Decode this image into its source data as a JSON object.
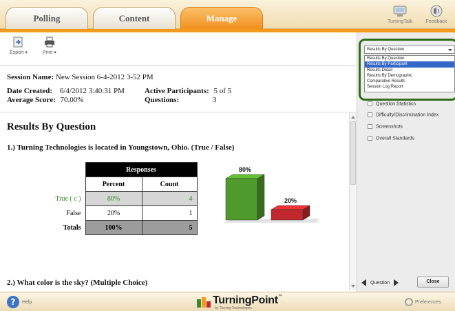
{
  "tabs": [
    {
      "label": "Polling",
      "active": false
    },
    {
      "label": "Content",
      "active": false
    },
    {
      "label": "Manage",
      "active": true
    }
  ],
  "top_actions": {
    "turningtalk": "TurningTalk",
    "feedback": "Feedback"
  },
  "toolbar": {
    "export": "Export",
    "print": "Print"
  },
  "session": {
    "name_label": "Session Name:",
    "name_value": "New Session 6-4-2012 3-52 PM",
    "date_label": "Date Created:",
    "date_value": "6/4/2012 3:40:31 PM",
    "avg_label": "Average Score:",
    "avg_value": "70.00%",
    "participants_label": "Active Participants:",
    "participants_value": "5 of 5",
    "questions_label": "Questions:",
    "questions_value": "3"
  },
  "report": {
    "title": "Results By Question",
    "q1": "1.) Turning Technologies is located in Youngstown, Ohio. (True / False)",
    "q2": "2.) What color is the sky? (Multiple Choice)"
  },
  "table": {
    "header": "Responses",
    "col_percent": "Percent",
    "col_count": "Count",
    "rows": [
      {
        "label": "True ( c )",
        "percent": "80%",
        "count": "4"
      },
      {
        "label": "False",
        "percent": "20%",
        "count": "1"
      },
      {
        "label": "Totals",
        "percent": "100%",
        "count": "5"
      }
    ]
  },
  "chart_data": {
    "type": "bar",
    "categories": [
      "True",
      "False"
    ],
    "values": [
      80,
      20
    ],
    "data_labels": [
      "80%",
      "20%"
    ],
    "colors": [
      "#4f9a2c",
      "#c0282d"
    ],
    "ylim": [
      0,
      100
    ]
  },
  "report_dropdown": {
    "selected": "Results By Question",
    "options": [
      "Results By Question",
      "Results By Participant",
      "Results Detail",
      "Results By Demographic",
      "Comparative Results",
      "Session Log Report"
    ],
    "highlighted_index": 1
  },
  "options_list": [
    {
      "label": "Question Statistics",
      "checked": false
    },
    {
      "label": "Difficulty/Discrimination Index",
      "checked": false
    },
    {
      "label": "Screenshots",
      "checked": false
    },
    {
      "label": "Overall Standards",
      "checked": false
    }
  ],
  "nav": {
    "question": "Question",
    "close": "Close"
  },
  "footer": {
    "help": "Help",
    "brand": "TurningPoint",
    "brand_sub": "by Turning Technologies",
    "preferences": "Preferences"
  },
  "colors": {
    "accent": "#f39a1f",
    "highlight_frame": "#2f6c1a",
    "selected_option": "#3467c7",
    "correct_text": "#3a8a2a"
  }
}
